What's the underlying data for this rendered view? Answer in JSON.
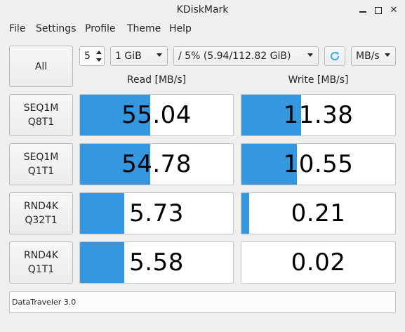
{
  "window": {
    "title": "KDiskMark"
  },
  "menu": [
    "File",
    "Settings",
    "Profile",
    "Theme",
    "Help"
  ],
  "controls": {
    "all_label": "All",
    "count_value": "5",
    "size_value": "1 GiB",
    "target_value": "/ 5% (5.94/112.82 GiB)",
    "unit_value": "MB/s"
  },
  "columns": {
    "read": "Read [MB/s]",
    "write": "Write [MB/s]"
  },
  "tests": [
    {
      "label": "SEQ1M\nQ8T1",
      "read": "55.04",
      "read_fill": 0.46,
      "write": "11.38",
      "write_fill": 0.39
    },
    {
      "label": "SEQ1M\nQ1T1",
      "read": "54.78",
      "read_fill": 0.46,
      "write": "10.55",
      "write_fill": 0.36
    },
    {
      "label": "RND4K\nQ32T1",
      "read": "5.73",
      "read_fill": 0.29,
      "write": "0.21",
      "write_fill": 0.05
    },
    {
      "label": "RND4K\nQ1T1",
      "read": "5.58",
      "read_fill": 0.29,
      "write": "0.02",
      "write_fill": 0.0
    }
  ],
  "status": {
    "device": "DataTraveler 3.0"
  },
  "colors": {
    "accent": "#3497e0",
    "background": "#efefef"
  },
  "icons": {
    "refresh": "refresh-icon"
  }
}
